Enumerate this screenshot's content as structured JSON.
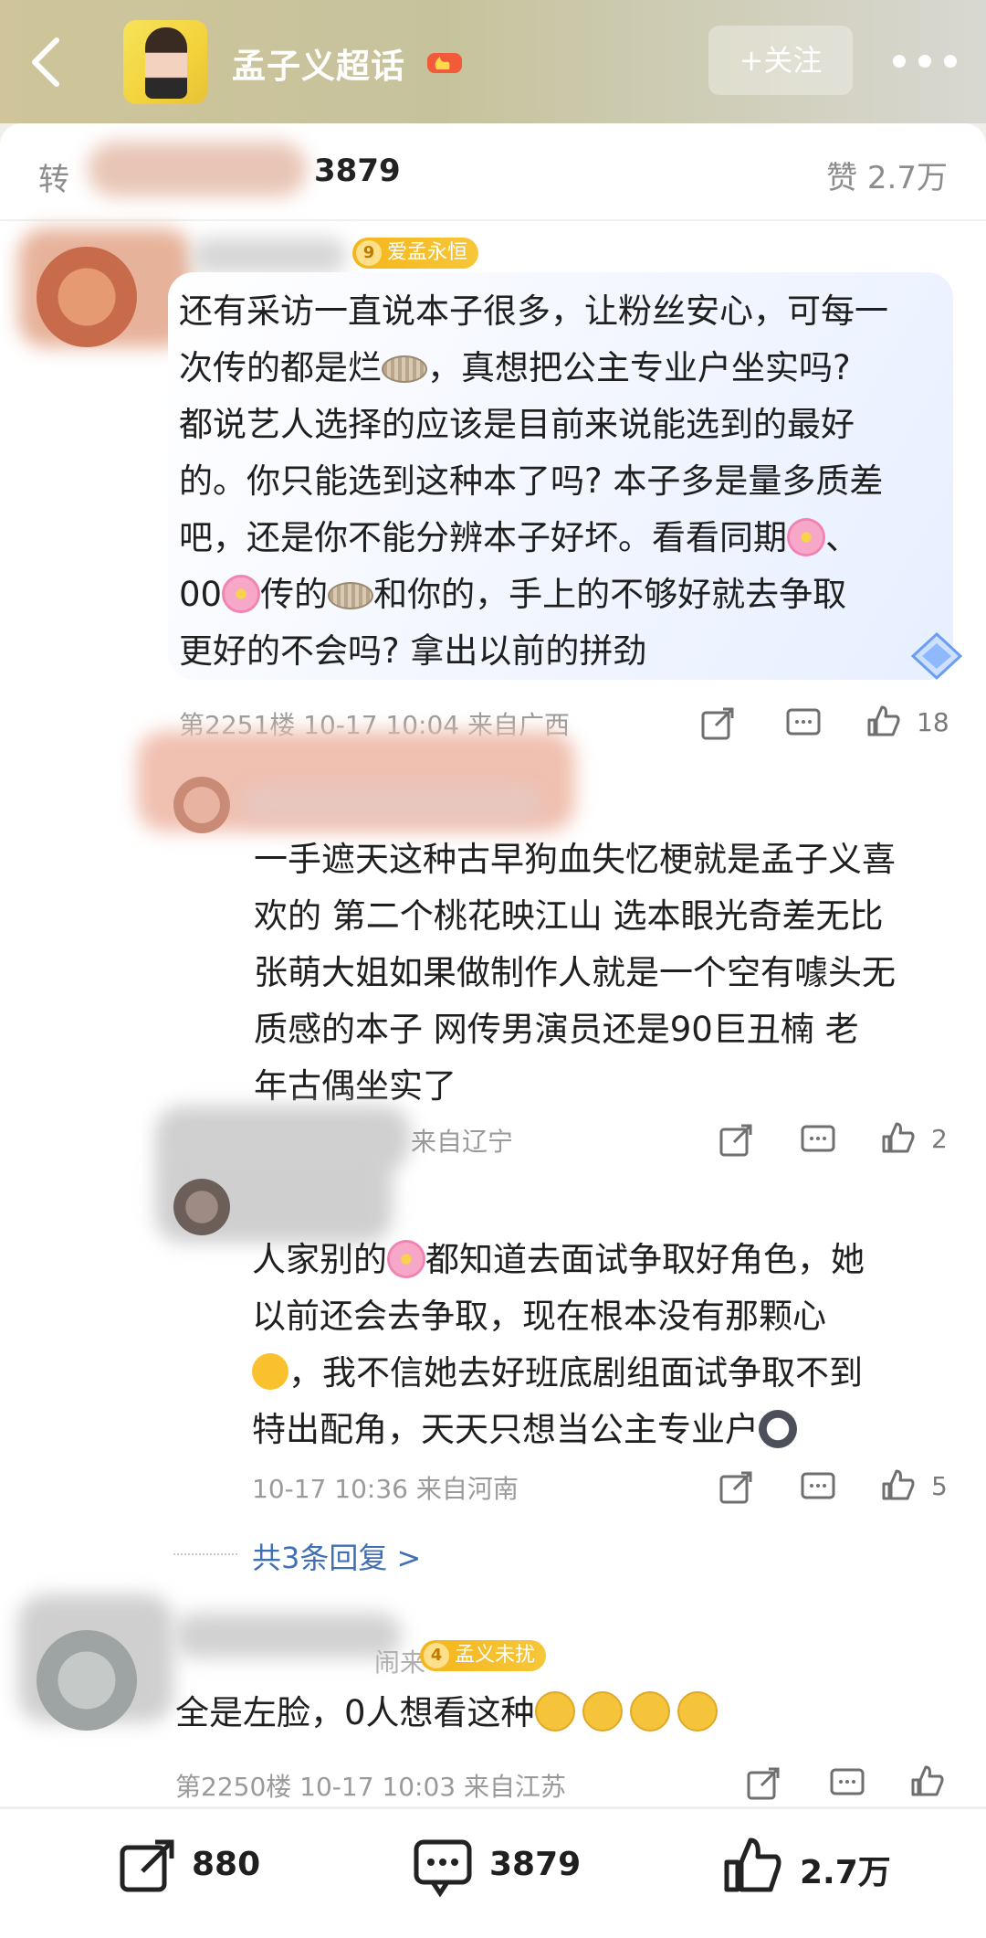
{
  "header": {
    "title": "孟子义超话",
    "follow_label": "+关注"
  },
  "stats": {
    "forward_label": "转",
    "comment_count": "3879",
    "like_label": "赞 2.7万"
  },
  "comments": [
    {
      "badge_level": "9",
      "badge_text": "爱孟永恒",
      "text_lines": [
        "还有采访一直说本子很多，让粉丝安心，可每一",
        "次传的都是烂",
        "，真想把公主专业户坐实吗?",
        "都说艺人选择的应该是目前来说能选到的最好",
        "的。你只能选到这种本了吗? 本子多是量多质差",
        "吧，还是你不能分辨本子好坏。看看同期",
        "、",
        "00",
        "传的",
        "和你的，手上的不够好就去争取",
        "更好的不会吗? 拿出以前的拼劲"
      ],
      "meta": "第2251楼 10-17 10:04 来自广西",
      "like_count": "18"
    },
    {
      "text_lines": [
        "一手遮天这种古早狗血失忆梗就是孟子义喜",
        "欢的  第二个桃花映江山  选本眼光奇差无比",
        "张萌大姐如果做制作人就是一个空有噱头无",
        "质感的本子  网传男演员还是90巨丑楠  老",
        "年古偶坐实了"
      ],
      "meta": "来自辽宁",
      "like_count": "2"
    },
    {
      "text_lines": [
        "人家别的",
        "都知道去面试争取好角色，她",
        "以前还会去争取，现在根本没有那颗心",
        "，我不信她去好班底剧组面试争取不到",
        "特出配角，天天只想当公主专业户"
      ],
      "meta": "10-17 10:36 来自河南",
      "like_count": "5"
    },
    {
      "more_replies": "共3条回复 >"
    },
    {
      "username_tail": "闹来",
      "badge_level": "4",
      "badge_text": "孟义未扰",
      "text": "全是左脸，0人想看这种",
      "meta": "第2250楼 10-17 10:03 来自江苏"
    }
  ],
  "bottom_bar": {
    "forward_count": "880",
    "comment_count": "3879",
    "like_count": "2.7万"
  },
  "icons": [
    "back-icon",
    "fire-badge-icon",
    "more-icon",
    "share-icon",
    "comment-icon",
    "like-icon",
    "gem-icon"
  ]
}
